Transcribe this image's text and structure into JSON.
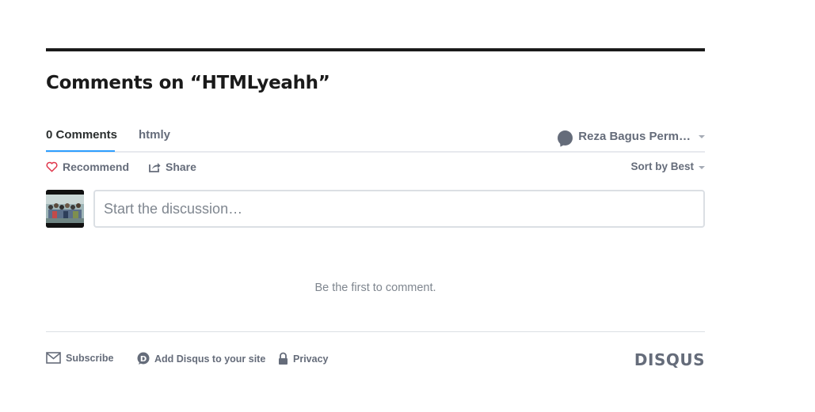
{
  "thread": {
    "title": "Comments on “HTMLyeahh”"
  },
  "tabs": [
    {
      "label": "0 Comments",
      "active": true
    },
    {
      "label": "htmly",
      "active": false
    }
  ],
  "user": {
    "name": "Reza Bagus Perm…",
    "icon": "user-bubble-icon"
  },
  "actions": {
    "recommend": "Recommend",
    "share": "Share",
    "sort": "Sort by Best"
  },
  "composer": {
    "placeholder": "Start the discussion…"
  },
  "empty_state": "Be the first to comment.",
  "footer": {
    "subscribe": "Subscribe",
    "add_disqus": "Add Disqus to your site",
    "privacy": "Privacy",
    "brand": "DISQUS"
  },
  "colors": {
    "accent": "#2e9fff",
    "text_dark": "#2a2e2e",
    "text_muted": "#656c7a",
    "heart": "#e0364b"
  }
}
